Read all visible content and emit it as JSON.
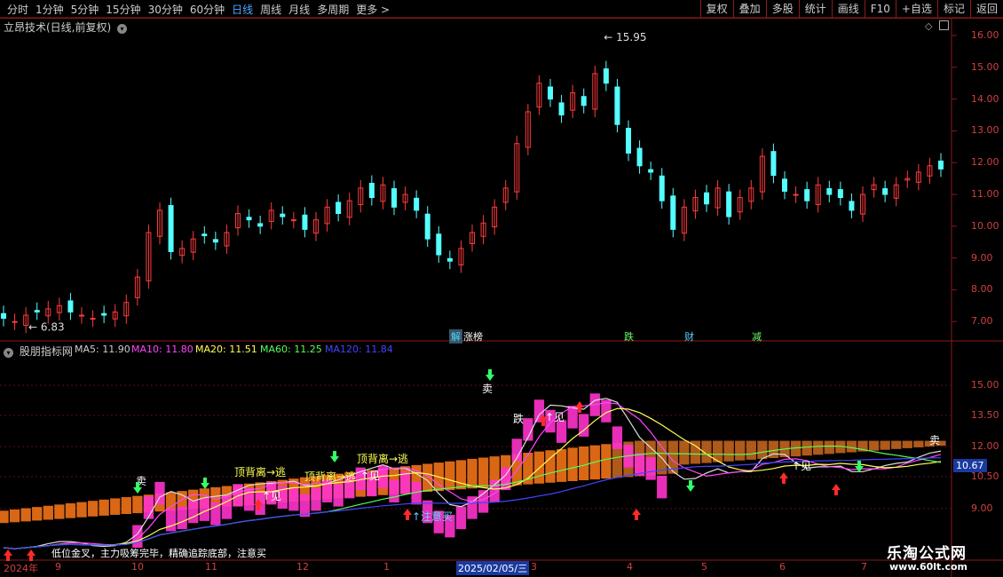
{
  "toolbar": {
    "periods": [
      "分时",
      "1分钟",
      "5分钟",
      "15分钟",
      "30分钟",
      "60分钟",
      "日线",
      "周线",
      "月线",
      "多周期",
      "更多 >"
    ],
    "active_period": "日线",
    "actions": [
      "复权",
      "叠加",
      "多股",
      "统计",
      "画线",
      "F10",
      "+自选",
      "标记",
      "返回"
    ]
  },
  "main_panel": {
    "title": "立昂技术(日线,前复权)",
    "high_marker": "15.95",
    "low_marker": "6.83",
    "axis_labels": [
      "16.00",
      "15.00",
      "14.00",
      "13.00",
      "12.00",
      "11.00",
      "10.00",
      "9.00",
      "8.00",
      "7.00"
    ],
    "event_flags": [
      {
        "text": "解",
        "color": "#5ad1ff"
      },
      {
        "text": "涨榜",
        "color": "#ffffff"
      },
      {
        "text": "跌",
        "color": "#66ff66"
      },
      {
        "text": "财",
        "color": "#5ad1ff"
      },
      {
        "text": "减",
        "color": "#66ff66"
      }
    ]
  },
  "indicator_panel": {
    "title": "股朋指标网",
    "ma_labels": [
      {
        "text": "MA5: 11.90",
        "color": "#cccccc"
      },
      {
        "text": "MA10: 11.80",
        "color": "#ff44ff"
      },
      {
        "text": "MA20: 11.51",
        "color": "#ffff55"
      },
      {
        "text": "MA60: 11.25",
        "color": "#55ff55"
      },
      {
        "text": "MA120: 11.84",
        "color": "#4444ff"
      }
    ],
    "axis_labels": [
      "15.00",
      "13.50",
      "12.00",
      "10.50",
      "9.00"
    ],
    "current_price": "10.67",
    "annotations": {
      "sell1": "卖",
      "sell2": "卖",
      "sell3": "卖",
      "top_div1": "顶背离→逃",
      "top_div2": "顶背离→逃",
      "top_div3": "顶背离→逃",
      "see1": "↑见",
      "see2": "↑见",
      "see3": "↑见",
      "see4": "↑见",
      "watch_buy": "↑注意买",
      "fall": "跌",
      "bottom_note": "低位金叉，主力吸筹完毕，精确追踪底部，注意买"
    }
  },
  "date_axis": {
    "labels": [
      "2024年",
      "9",
      "10",
      "11",
      "12",
      "1",
      "3",
      "4",
      "5",
      "6",
      "7"
    ],
    "cursor_date": "2025/02/05/三"
  },
  "watermark": {
    "line1": "乐淘公式网",
    "line2": "www.60lt.com"
  },
  "chart_data": {
    "type": "candlestick",
    "title": "立昂技术(日线,前复权)",
    "ylim": [
      6.5,
      16.3
    ],
    "highest": 15.95,
    "lowest": 6.83,
    "close_series": [
      7.1,
      7.0,
      7.2,
      7.3,
      7.4,
      7.5,
      7.3,
      7.2,
      7.1,
      7.2,
      7.3,
      7.6,
      8.4,
      9.8,
      10.5,
      9.2,
      9.3,
      9.6,
      9.7,
      9.5,
      9.8,
      10.4,
      10.2,
      10.0,
      10.5,
      10.3,
      10.2,
      9.9,
      10.2,
      10.6,
      10.4,
      10.8,
      11.2,
      10.9,
      11.3,
      10.6,
      11.0,
      10.5,
      9.6,
      9.1,
      8.9,
      9.3,
      9.8,
      10.1,
      10.6,
      11.2,
      12.6,
      13.6,
      14.5,
      14.0,
      13.5,
      14.2,
      13.8,
      14.8,
      14.5,
      13.2,
      12.3,
      11.9,
      11.7,
      10.8,
      9.9,
      10.6,
      10.9,
      10.7,
      11.2,
      10.3,
      10.9,
      11.2,
      12.2,
      11.6,
      11.1,
      11.0,
      10.8,
      11.3,
      11.0,
      10.9,
      10.5,
      11.0,
      11.3,
      11.0,
      11.3,
      11.5,
      11.7,
      11.9,
      11.8
    ]
  }
}
